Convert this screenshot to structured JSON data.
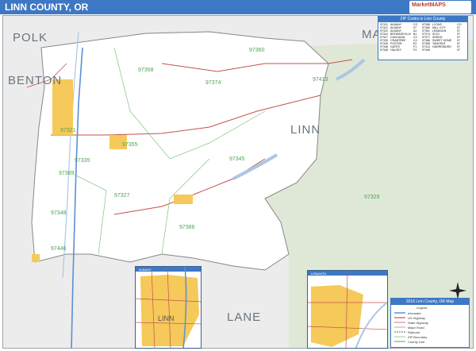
{
  "header": {
    "title": "LINN COUNTY, OR",
    "logo_text": "MarketMAPS"
  },
  "colors": {
    "header_blue": "#3d78c4",
    "forest_green": "#dfe8d6",
    "urban_orange": "#f5c95a",
    "water_blue": "#a9c7e6",
    "county_gray": "#e9e9e9",
    "road_red": "#c4524c",
    "zip_green": "#4fa34f"
  },
  "county_labels": {
    "polk": "POLK",
    "benton": "BENTON",
    "marion": "MAR",
    "linn": "LINN",
    "lane": "LANE"
  },
  "zip_labels": [
    "97360",
    "97374",
    "97345",
    "97358",
    "97355",
    "97327",
    "97348",
    "97321",
    "97386",
    "97389",
    "97413",
    "97446",
    "97335",
    "97329"
  ],
  "zip_table": {
    "header": "ZIP Codes in Linn County",
    "rows": [
      [
        "97101",
        "ALBANY",
        "CO",
        "97358",
        "LYONS",
        "CO"
      ],
      [
        "97321",
        "ALBANY",
        "97",
        "97360",
        "MILL CITY",
        "97"
      ],
      [
        "97322",
        "ALBANY",
        "A1",
        "97361",
        "LEBANON",
        "97"
      ],
      [
        "97324",
        "BROWNSVILLE",
        "B1",
        "97374",
        "SCIO",
        "97"
      ],
      [
        "97327",
        "CASCADIA",
        "C2",
        "97377",
        "SHEDD",
        "97"
      ],
      [
        "97335",
        "CRABTREE",
        "C4",
        "97386",
        "SWEET HOME",
        "97"
      ],
      [
        "97345",
        "FOSTER",
        "E2",
        "97389",
        "TANGENT",
        "97"
      ],
      [
        "97346",
        "GATES",
        "F1",
        "97413",
        "HARRISBURG",
        "97"
      ],
      [
        "97348",
        "HALSEY",
        "F4",
        "97446",
        "",
        "97"
      ]
    ]
  },
  "insets": {
    "left_title": "ALBANY",
    "right_title": "LEBANON",
    "left_label": "LINN"
  },
  "legend": {
    "title": "2016 Linn County, OR Map",
    "subtitle": "Legend",
    "items": [
      "Interstate",
      "US Highway",
      "State Highway",
      "Major Road",
      "Railroad",
      "ZIP Boundary",
      "County Line"
    ]
  }
}
